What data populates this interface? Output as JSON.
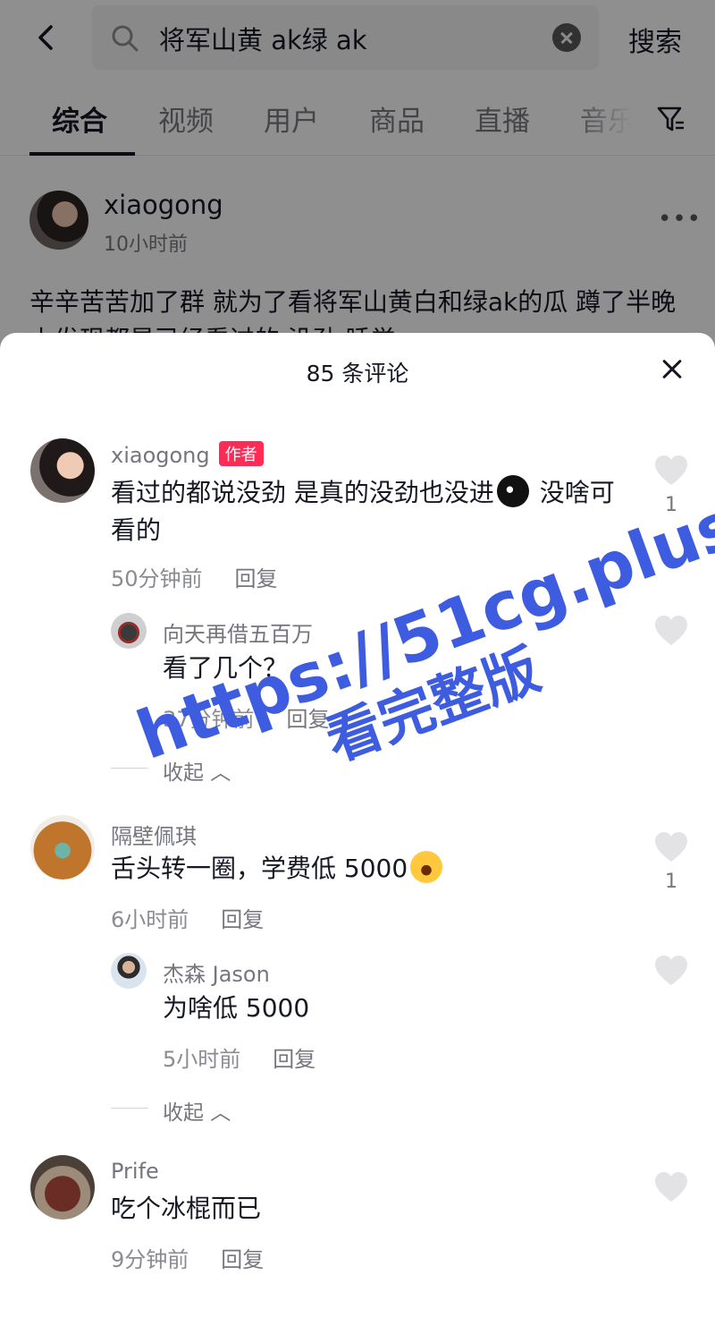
{
  "search": {
    "query": "将军山黄 ak绿 ak",
    "action_label": "搜索"
  },
  "tabs": [
    "综合",
    "视频",
    "用户",
    "商品",
    "直播",
    "音乐"
  ],
  "post": {
    "user": "xiaogong",
    "time": "10小时前",
    "text": "辛辛苦苦加了群 就为了看将军山黄白和绿ak的瓜 蹲了半晚上发现都是已经看过的 没劲 睡觉"
  },
  "sheet": {
    "title": "85 条评论"
  },
  "comments": [
    {
      "user": "xiaogong",
      "badge": "作者",
      "text_before": "看过的都说没劲 是真的没劲也没进",
      "text_after": " 没啥可看的",
      "time": "50分钟前",
      "reply": "回复",
      "likes": "1",
      "replies": [
        {
          "user": "向天再借五百万",
          "text": "看了几个？",
          "time": "37分钟前",
          "reply": "回复"
        }
      ],
      "collapse": "收起"
    },
    {
      "user": "隔壁佩琪",
      "text": "舌头转一圈，学费低 5000",
      "time": "6小时前",
      "reply": "回复",
      "likes": "1",
      "replies": [
        {
          "user": "杰森 Jason",
          "text": "为啥低 5000",
          "time": "5小时前",
          "reply": "回复"
        }
      ],
      "collapse": "收起"
    },
    {
      "user": "Prife",
      "text": "吃个冰棍而已",
      "time": "9分钟前",
      "reply": "回复"
    }
  ],
  "watermark": {
    "line1": "https://51cg.plus",
    "line2": "看完整版"
  },
  "colors": {
    "accent_badge": "#fe2c55",
    "watermark": "#3d5ce0"
  }
}
